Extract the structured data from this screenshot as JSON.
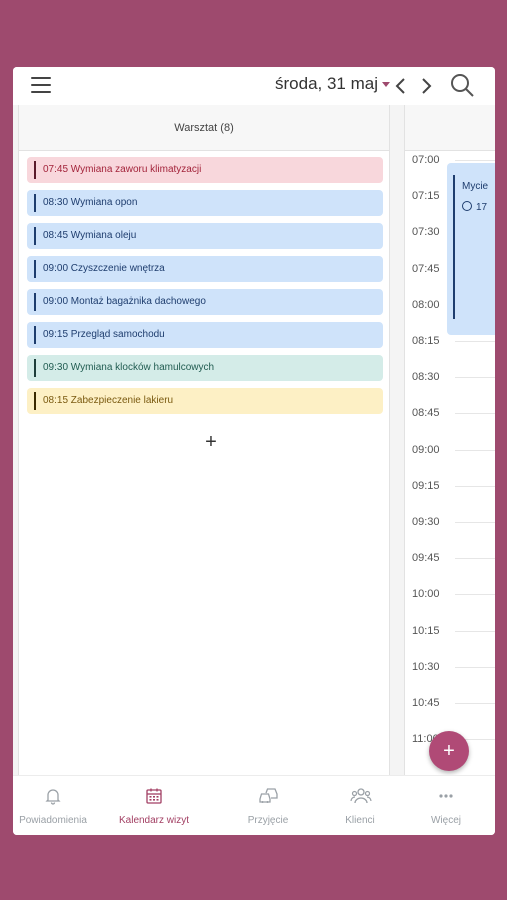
{
  "header": {
    "date_label": "środa, 31 maj"
  },
  "workshop_column": {
    "header": "Warsztat (8)",
    "appointments": [
      {
        "label": "07:45 Wymiana zaworu klimatyzacji",
        "color": "red"
      },
      {
        "label": "08:30 Wymiana opon",
        "color": "blue"
      },
      {
        "label": "08:45 Wymiana oleju",
        "color": "blue"
      },
      {
        "label": "09:00 Czyszczenie wnętrza",
        "color": "blue"
      },
      {
        "label": "09:00 Montaż bagażnika dachowego",
        "color": "blue"
      },
      {
        "label": "09:15 Przegląd samochodu",
        "color": "blue"
      },
      {
        "label": "09:30 Wymiana klocków hamulcowych",
        "color": "teal"
      },
      {
        "label": "08:15 Zabezpieczenie lakieru",
        "color": "yellow"
      }
    ],
    "add_symbol": "+"
  },
  "schedule": {
    "times": [
      "07:00",
      "07:15",
      "07:30",
      "07:45",
      "08:00",
      "08:15",
      "08:30",
      "08:45",
      "09:00",
      "09:15",
      "09:30",
      "09:45",
      "10:00",
      "10:15",
      "10:30",
      "10:45",
      "11:00"
    ],
    "event": {
      "title": "Mycie",
      "meta": "17"
    }
  },
  "fab_symbol": "+",
  "bottom_nav": [
    {
      "label": "Powiadomienia",
      "icon": "bell-icon",
      "active": false
    },
    {
      "label": "Kalendarz wizyt",
      "icon": "calendar-icon",
      "active": true
    },
    {
      "label": "Przyjęcie",
      "icon": "cars-icon",
      "active": false
    },
    {
      "label": "Klienci",
      "icon": "users-icon",
      "active": false
    },
    {
      "label": "Więcej",
      "icon": "more-icon",
      "active": false
    }
  ],
  "colors": {
    "accent": "#a23f63",
    "background": "#9e4a6e",
    "appt_blue": "#cfe3fa",
    "appt_red": "#f8d7dc",
    "appt_teal": "#d4ece8",
    "appt_yellow": "#fdf0c5"
  }
}
